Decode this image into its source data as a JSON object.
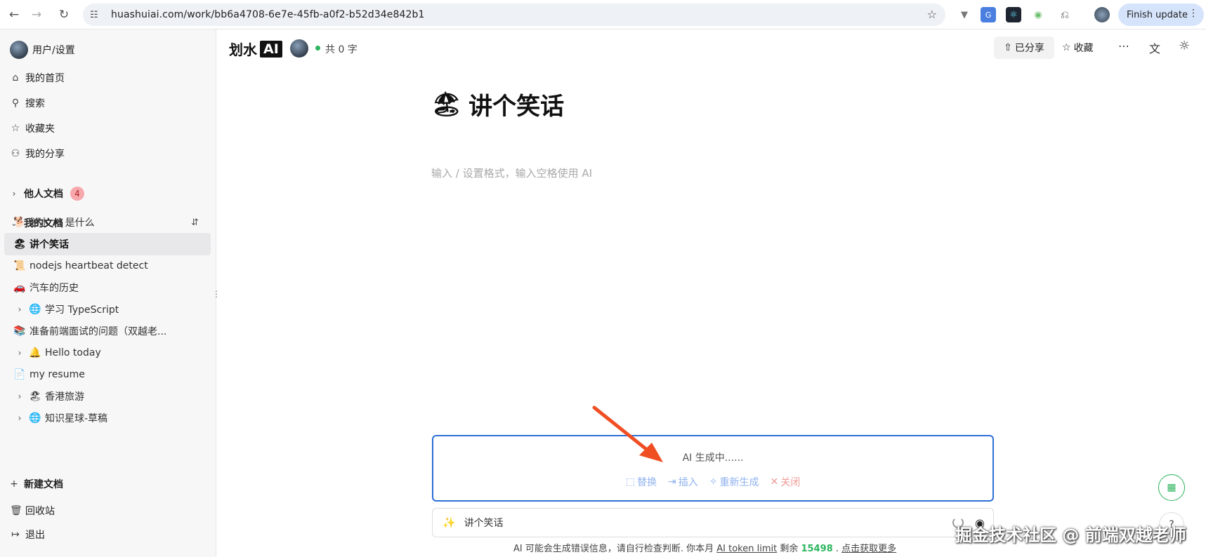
{
  "browser": {
    "url": "huashuiai.com/work/bb6a4708-6e7e-45fb-a0f2-b52d34e842b1",
    "finish_update": "Finish update"
  },
  "sidebar": {
    "user_label": "用户/设置",
    "nav": [
      {
        "label": "我的首页",
        "icon": "home-icon",
        "glyph": "⌂"
      },
      {
        "label": "搜索",
        "icon": "search-icon",
        "glyph": "⚲"
      },
      {
        "label": "收藏夹",
        "icon": "star-icon",
        "glyph": "☆"
      },
      {
        "label": "我的分享",
        "icon": "users-icon",
        "glyph": "⚇"
      }
    ],
    "others_docs": {
      "label": "他人文档",
      "count": "4"
    },
    "my_docs_label": "我的文档",
    "docs": [
      {
        "emoji": "🐕",
        "label": "划水 AI 是什么",
        "has_children": false,
        "active": false
      },
      {
        "emoji": "🏖",
        "label": "讲个笑话",
        "has_children": false,
        "active": true
      },
      {
        "emoji": "📜",
        "label": "nodejs heartbeat detect",
        "has_children": false,
        "active": false
      },
      {
        "emoji": "🚗",
        "label": "汽车的历史",
        "has_children": false,
        "active": false
      },
      {
        "emoji": "🌐",
        "label": "学习 TypeScript",
        "has_children": true,
        "active": false
      },
      {
        "emoji": "📚",
        "label": "准备前端面试的问题（双越老...",
        "has_children": false,
        "active": false
      },
      {
        "emoji": "🔔",
        "label": "Hello today",
        "has_children": true,
        "active": false
      },
      {
        "emoji": "📄",
        "label": "my resume",
        "has_children": false,
        "active": false
      },
      {
        "emoji": "🏖",
        "label": "香港旅游",
        "has_children": true,
        "active": false
      },
      {
        "emoji": "🌐",
        "label": "知识星球-草稿",
        "has_children": true,
        "active": false
      }
    ],
    "new_doc": "新建文档",
    "trash": "回收站",
    "logout": "退出"
  },
  "header": {
    "logo_text": "划水",
    "logo_ai": "AI",
    "word_count": "共 0 字",
    "shared_label": "已分享",
    "favorite_label": "收藏"
  },
  "editor": {
    "title_emoji": "🏖",
    "title": "讲个笑话",
    "placeholder": "输入 / 设置格式，输入空格使用 AI"
  },
  "ai_panel": {
    "status": "AI 生成中......",
    "actions": [
      {
        "label": "替换",
        "icon": "replace-icon",
        "glyph": "⬚"
      },
      {
        "label": "插入",
        "icon": "insert-icon",
        "glyph": "⇥"
      },
      {
        "label": "重新生成",
        "icon": "sparkle-icon",
        "glyph": "✧"
      },
      {
        "label": "关闭",
        "icon": "close-icon",
        "glyph": "✕"
      }
    ],
    "prompt_value": "讲个笑话"
  },
  "footer": {
    "text1": "AI 可能会生成错误信息，请自行检查判断. 你本月",
    "token_link": "AI token limit",
    "text2": "剩余",
    "remaining": "15498",
    "text3": ".",
    "more_link": "点击获取更多"
  },
  "watermark": "掘金技术社区 @ 前端双越老师",
  "colors": {
    "accent": "#2b6fd6",
    "green": "#2bb55c",
    "arrow": "#f04e23"
  }
}
